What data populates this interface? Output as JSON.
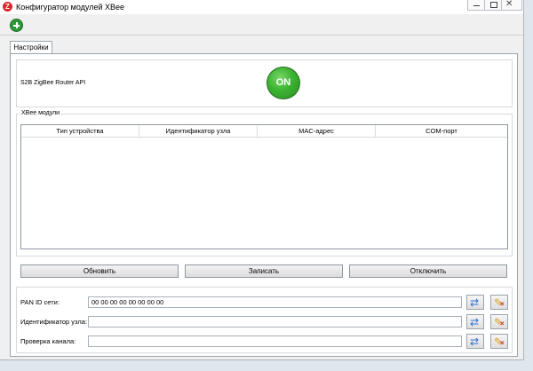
{
  "window": {
    "title": "Конфигуратор модулей XBee",
    "app_icon_letter": "Z"
  },
  "toolbar": {
    "add_icon": "plus-circle-icon"
  },
  "tabs": [
    {
      "label": "Настройки"
    }
  ],
  "router": {
    "label": "S2B ZigBee Router API",
    "toggle_text": "ON",
    "toggle_color": "#3cb332"
  },
  "xbee_group": {
    "title": "XBee модули",
    "columns": [
      "Тип устройства",
      "Идентификатор узла",
      "MAC-адрес",
      "COM-порт"
    ],
    "rows": []
  },
  "buttons": {
    "refresh": "Обновить",
    "write": "Записать",
    "disconnect": "Отключить"
  },
  "fields": [
    {
      "label": "PAN ID сети:",
      "value": "00 00 00 00 00 00 00 00"
    },
    {
      "label": "Идентификатор узла:",
      "value": ""
    },
    {
      "label": "Проверка канала:",
      "value": ""
    }
  ]
}
